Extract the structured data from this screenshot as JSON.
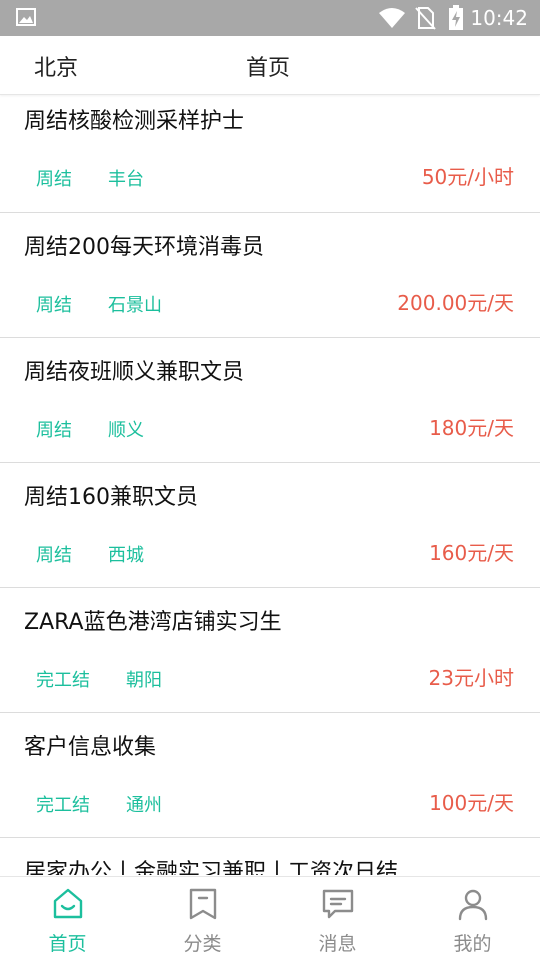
{
  "status_bar": {
    "time": "10:42"
  },
  "header": {
    "city": "北京",
    "title": "首页"
  },
  "jobs": [
    {
      "title": "周结核酸检测采样护士",
      "tags": [
        "周结",
        "丰台"
      ],
      "salary": "50元/小时"
    },
    {
      "title": "周结200每天环境消毒员",
      "tags": [
        "周结",
        "石景山"
      ],
      "salary": "200.00元/天"
    },
    {
      "title": "周结夜班顺义兼职文员",
      "tags": [
        "周结",
        "顺义"
      ],
      "salary": "180元/天"
    },
    {
      "title": "周结160兼职文员",
      "tags": [
        "周结",
        "西城"
      ],
      "salary": "160元/天"
    },
    {
      "title": "ZARA蓝色港湾店铺实习生",
      "tags": [
        "完工结",
        "朝阳"
      ],
      "salary": "23元小时"
    },
    {
      "title": "客户信息收集",
      "tags": [
        "完工结",
        "通州"
      ],
      "salary": "100元/天"
    },
    {
      "title": "居家办公丨金融实习兼职丨工资次日结",
      "tags": [],
      "salary": ""
    }
  ],
  "tabbar": [
    {
      "label": "首页",
      "icon": "home-icon",
      "active": true
    },
    {
      "label": "分类",
      "icon": "bookmark-icon",
      "active": false
    },
    {
      "label": "消息",
      "icon": "message-icon",
      "active": false
    },
    {
      "label": "我的",
      "icon": "user-icon",
      "active": false
    }
  ],
  "colors": {
    "accent": "#1cbf9d",
    "salary": "#e85c4a",
    "statusbar": "#a8a8a8"
  }
}
